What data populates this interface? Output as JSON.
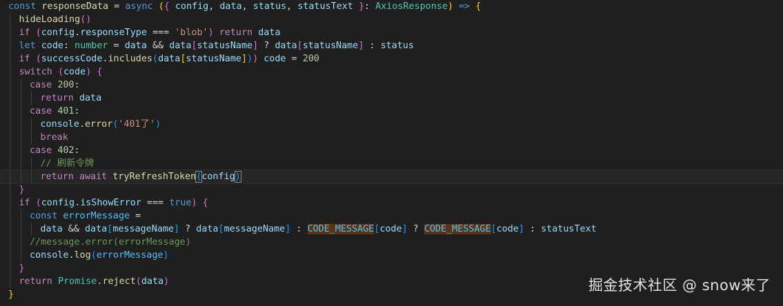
{
  "editor": {
    "colors": {
      "background": "#1f1f1f",
      "keyword": "#569cd6",
      "control": "#c586c0",
      "function": "#dcdcaa",
      "variable": "#9cdcfe",
      "constant": "#4fc1ff",
      "string": "#ce9178",
      "number": "#b5cea8",
      "type": "#4ec9b0",
      "comment": "#6a9955"
    },
    "lines": [
      {
        "indent": 0,
        "active": false,
        "tokens": [
          [
            "kw",
            "const"
          ],
          [
            "op",
            " "
          ],
          [
            "fn",
            "responseData"
          ],
          [
            "op",
            " = "
          ],
          [
            "kw",
            "async"
          ],
          [
            "op",
            " "
          ],
          [
            "p1",
            "("
          ],
          [
            "p2",
            "{"
          ],
          [
            "op",
            " "
          ],
          [
            "var",
            "config"
          ],
          [
            "op",
            ", "
          ],
          [
            "var",
            "data"
          ],
          [
            "op",
            ", "
          ],
          [
            "var",
            "status"
          ],
          [
            "op",
            ", "
          ],
          [
            "var",
            "statusText"
          ],
          [
            "op",
            " "
          ],
          [
            "p2",
            "}"
          ],
          [
            "op",
            ": "
          ],
          [
            "type",
            "AxiosResponse"
          ],
          [
            "p1",
            ")"
          ],
          [
            "op",
            " "
          ],
          [
            "kw",
            "=>"
          ],
          [
            "op",
            " "
          ],
          [
            "p1",
            "{"
          ]
        ]
      },
      {
        "indent": 1,
        "active": false,
        "tokens": [
          [
            "fn",
            "hideLoading"
          ],
          [
            "p2",
            "()"
          ]
        ]
      },
      {
        "indent": 1,
        "active": false,
        "tokens": [
          [
            "ctrl",
            "if"
          ],
          [
            "op",
            " "
          ],
          [
            "p2",
            "("
          ],
          [
            "var",
            "config"
          ],
          [
            "op",
            "."
          ],
          [
            "var",
            "responseType"
          ],
          [
            "op",
            " === "
          ],
          [
            "str",
            "'blob'"
          ],
          [
            "p2",
            ")"
          ],
          [
            "op",
            " "
          ],
          [
            "ctrl",
            "return"
          ],
          [
            "op",
            " "
          ],
          [
            "var",
            "data"
          ]
        ]
      },
      {
        "indent": 1,
        "active": false,
        "tokens": [
          [
            "kw",
            "let"
          ],
          [
            "op",
            " "
          ],
          [
            "var",
            "code"
          ],
          [
            "op",
            ": "
          ],
          [
            "type",
            "number"
          ],
          [
            "op",
            " = "
          ],
          [
            "var",
            "data"
          ],
          [
            "op",
            " && "
          ],
          [
            "var",
            "data"
          ],
          [
            "p2",
            "["
          ],
          [
            "var",
            "statusName"
          ],
          [
            "p2",
            "]"
          ],
          [
            "op",
            " ? "
          ],
          [
            "var",
            "data"
          ],
          [
            "p2",
            "["
          ],
          [
            "var",
            "statusName"
          ],
          [
            "p2",
            "]"
          ],
          [
            "op",
            " : "
          ],
          [
            "var",
            "status"
          ]
        ]
      },
      {
        "indent": 1,
        "active": false,
        "tokens": [
          [
            "ctrl",
            "if"
          ],
          [
            "op",
            " "
          ],
          [
            "p2",
            "("
          ],
          [
            "var",
            "successCode"
          ],
          [
            "op",
            "."
          ],
          [
            "fn",
            "includes"
          ],
          [
            "p3",
            "("
          ],
          [
            "var",
            "data"
          ],
          [
            "p1",
            "["
          ],
          [
            "var",
            "statusName"
          ],
          [
            "p1",
            "]"
          ],
          [
            "p3",
            ")"
          ],
          [
            "p2",
            ")"
          ],
          [
            "op",
            " "
          ],
          [
            "var",
            "code"
          ],
          [
            "op",
            " = "
          ],
          [
            "num",
            "200"
          ]
        ]
      },
      {
        "indent": 1,
        "active": false,
        "tokens": [
          [
            "ctrl",
            "switch"
          ],
          [
            "op",
            " "
          ],
          [
            "p2",
            "("
          ],
          [
            "var",
            "code"
          ],
          [
            "p2",
            ")"
          ],
          [
            "op",
            " "
          ],
          [
            "p2",
            "{"
          ]
        ]
      },
      {
        "indent": 2,
        "active": false,
        "tokens": [
          [
            "ctrl",
            "case"
          ],
          [
            "op",
            " "
          ],
          [
            "num",
            "200"
          ],
          [
            "op",
            ":"
          ]
        ]
      },
      {
        "indent": 3,
        "active": false,
        "tokens": [
          [
            "ctrl",
            "return"
          ],
          [
            "op",
            " "
          ],
          [
            "var",
            "data"
          ]
        ]
      },
      {
        "indent": 2,
        "active": false,
        "tokens": [
          [
            "ctrl",
            "case"
          ],
          [
            "op",
            " "
          ],
          [
            "num",
            "401"
          ],
          [
            "op",
            ":"
          ]
        ]
      },
      {
        "indent": 3,
        "active": false,
        "tokens": [
          [
            "var",
            "console"
          ],
          [
            "op",
            "."
          ],
          [
            "fn",
            "error"
          ],
          [
            "p3",
            "("
          ],
          [
            "str",
            "'401了'"
          ],
          [
            "p3",
            ")"
          ]
        ]
      },
      {
        "indent": 3,
        "active": false,
        "tokens": [
          [
            "ctrl",
            "break"
          ]
        ]
      },
      {
        "indent": 2,
        "active": false,
        "tokens": [
          [
            "ctrl",
            "case"
          ],
          [
            "op",
            " "
          ],
          [
            "num",
            "402"
          ],
          [
            "op",
            ":"
          ]
        ]
      },
      {
        "indent": 3,
        "active": false,
        "tokens": [
          [
            "cmt",
            "// 刷新令牌"
          ]
        ]
      },
      {
        "indent": 3,
        "active": true,
        "tokens": [
          [
            "ctrl",
            "return"
          ],
          [
            "op",
            " "
          ],
          [
            "ctrl",
            "await"
          ],
          [
            "op",
            " "
          ],
          [
            "fn",
            "tryRefreshToken"
          ],
          [
            "p3b",
            "("
          ],
          [
            "var",
            "config"
          ],
          [
            "p3b",
            ")"
          ]
        ]
      },
      {
        "indent": 1,
        "active": false,
        "tokens": [
          [
            "p2",
            "}"
          ]
        ]
      },
      {
        "indent": 1,
        "active": false,
        "tokens": [
          [
            "ctrl",
            "if"
          ],
          [
            "op",
            " "
          ],
          [
            "p2",
            "("
          ],
          [
            "var",
            "config"
          ],
          [
            "op",
            "."
          ],
          [
            "var",
            "isShowError"
          ],
          [
            "op",
            " === "
          ],
          [
            "kw",
            "true"
          ],
          [
            "p2",
            ")"
          ],
          [
            "op",
            " "
          ],
          [
            "p2",
            "{"
          ]
        ]
      },
      {
        "indent": 2,
        "active": false,
        "tokens": [
          [
            "kw",
            "const"
          ],
          [
            "op",
            " "
          ],
          [
            "cst",
            "errorMessage"
          ],
          [
            "op",
            " ="
          ]
        ]
      },
      {
        "indent": 3,
        "active": false,
        "tokens": [
          [
            "var",
            "data"
          ],
          [
            "op",
            " && "
          ],
          [
            "var",
            "data"
          ],
          [
            "p3",
            "["
          ],
          [
            "var",
            "messageName"
          ],
          [
            "p3",
            "]"
          ],
          [
            "op",
            " ? "
          ],
          [
            "var",
            "data"
          ],
          [
            "p3",
            "["
          ],
          [
            "var",
            "messageName"
          ],
          [
            "p3",
            "]"
          ],
          [
            "op",
            " : "
          ],
          [
            "cstH",
            "CODE_MESSAGE"
          ],
          [
            "p3",
            "["
          ],
          [
            "var",
            "code"
          ],
          [
            "p3",
            "]"
          ],
          [
            "op",
            " ? "
          ],
          [
            "cstH",
            "CODE_MESSAGE"
          ],
          [
            "p3",
            "["
          ],
          [
            "var",
            "code"
          ],
          [
            "p3",
            "]"
          ],
          [
            "op",
            " : "
          ],
          [
            "var",
            "statusText"
          ]
        ]
      },
      {
        "indent": 2,
        "active": false,
        "tokens": [
          [
            "cmt",
            "//message.error(errorMessage)"
          ]
        ]
      },
      {
        "indent": 2,
        "active": false,
        "tokens": [
          [
            "var",
            "console"
          ],
          [
            "op",
            "."
          ],
          [
            "fn",
            "log"
          ],
          [
            "p3",
            "("
          ],
          [
            "cst",
            "errorMessage"
          ],
          [
            "p3",
            ")"
          ]
        ]
      },
      {
        "indent": 1,
        "active": false,
        "tokens": [
          [
            "p2",
            "}"
          ]
        ]
      },
      {
        "indent": 1,
        "active": false,
        "tokens": [
          [
            "ctrl",
            "return"
          ],
          [
            "op",
            " "
          ],
          [
            "type",
            "Promise"
          ],
          [
            "op",
            "."
          ],
          [
            "fn",
            "reject"
          ],
          [
            "p2",
            "("
          ],
          [
            "var",
            "data"
          ],
          [
            "p2",
            ")"
          ]
        ]
      },
      {
        "indent": 0,
        "active": false,
        "tokens": [
          [
            "p1",
            "}"
          ]
        ]
      }
    ]
  },
  "watermark": {
    "text": "掘金技术社区 @ snow来了"
  }
}
